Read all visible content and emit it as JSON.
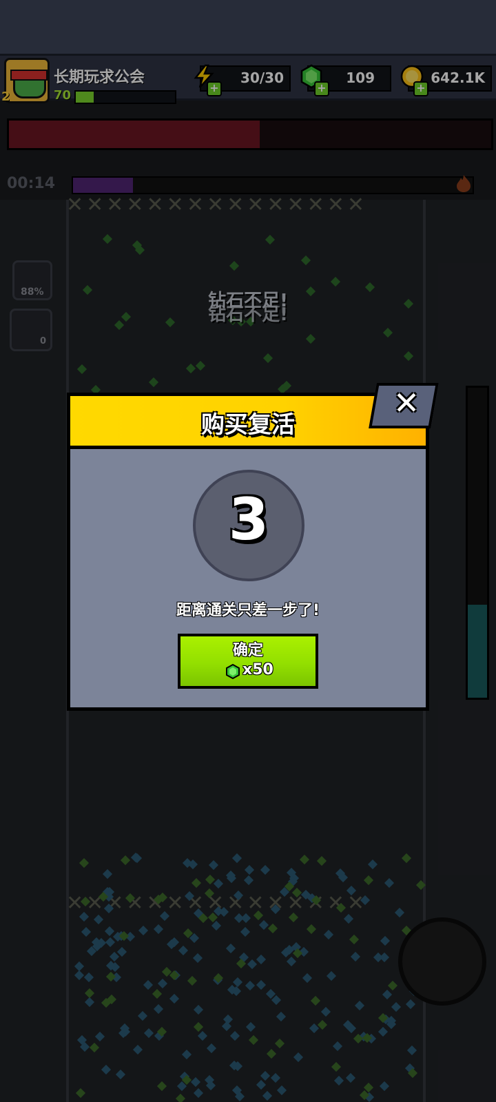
{
  "player": {
    "name": "长期玩求公会",
    "level": "70",
    "rank_badge": "2",
    "xp_fraction": 0.18
  },
  "resources": {
    "energy": "30/30",
    "gems": "109",
    "coins": "642.1K"
  },
  "battle": {
    "timer": "00:14",
    "boss_hp_fraction": 0.52,
    "wave_progress_fraction": 0.15,
    "gauge_percent": "88%",
    "skill_counter": "0",
    "warning_text": "钻石不足!"
  },
  "revive_dialog": {
    "title": "购买复活",
    "countdown": "3",
    "message": "距离通关只差一步了!",
    "confirm_label": "确定",
    "cost_text": "x50"
  },
  "colors": {
    "accent_yellow": "#ffd900",
    "confirm_green": "#93df00",
    "dialog_body": "#7c8499",
    "boss_hp": "#6b1622"
  },
  "icons": {
    "energy": "lightning-icon",
    "gems": "green-gem-icon",
    "coins": "gold-coin-icon",
    "close": "close-icon"
  }
}
